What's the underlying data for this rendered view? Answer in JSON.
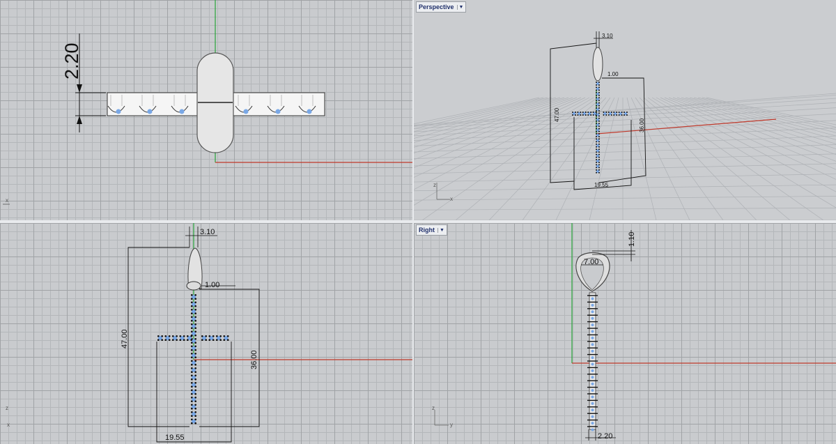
{
  "viewports": {
    "top_left": {
      "axis_x_label": "x"
    },
    "top_right": {
      "title": "Perspective",
      "axis_z_label": "z",
      "axis_x_label": "x",
      "dims": {
        "bail_width": "3.10",
        "gap": "1.00",
        "total_height": "47.00",
        "body_height": "36.00",
        "arm_width": "19.55"
      }
    },
    "bottom_left": {
      "axis_z_label": "z",
      "axis_x_label": "x",
      "dims": {
        "bail_width": "3.10",
        "gap": "1.00",
        "total_height": "47.00",
        "body_height": "36.00",
        "arm_width": "19.55"
      }
    },
    "bottom_right": {
      "title": "Right",
      "axis_z_label": "z",
      "axis_y_label": "y",
      "dims": {
        "bail_top": "1.10",
        "bail_inner": "7.00",
        "thickness": "2.20"
      }
    }
  },
  "top_left_dims": {
    "thickness": "2.20"
  },
  "colors": {
    "axis_x": "#c0392b",
    "axis_y": "#27a53a",
    "gem": "#7aa8e6",
    "prong": "#111111",
    "dim": "#111111"
  }
}
